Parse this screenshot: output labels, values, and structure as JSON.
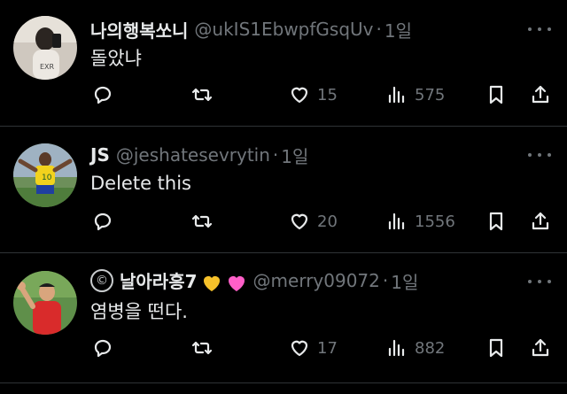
{
  "tweets": [
    {
      "name": "나의행복쏘니",
      "handle": "@ukIS1EbwpfGsqUv",
      "separator": "·",
      "time": "1일",
      "text": "돌았냐",
      "likes": "15",
      "views": "575"
    },
    {
      "name": "JS",
      "handle": "@jeshatesevrytin",
      "separator": "·",
      "time": "1일",
      "text": "Delete this",
      "likes": "20",
      "views": "1556"
    },
    {
      "badge": "©",
      "name": "날아라흥7",
      "handle": "@merry09072",
      "separator": "·",
      "time": "1일",
      "text": "염병을 떤다.",
      "likes": "17",
      "views": "882",
      "emojis": [
        "yellow-heart",
        "pink-heart"
      ]
    }
  ],
  "icons": {
    "reply": "reply-icon",
    "retweet": "retweet-icon",
    "like": "heart-icon",
    "views": "views-icon",
    "bookmark": "bookmark-icon",
    "share": "share-icon",
    "more": "more-icon"
  },
  "colors": {
    "background": "#000000",
    "text": "#e7e9ea",
    "muted": "#71767b",
    "yellow_heart": "#f6c12a",
    "pink_heart": "#ff5fc8"
  }
}
